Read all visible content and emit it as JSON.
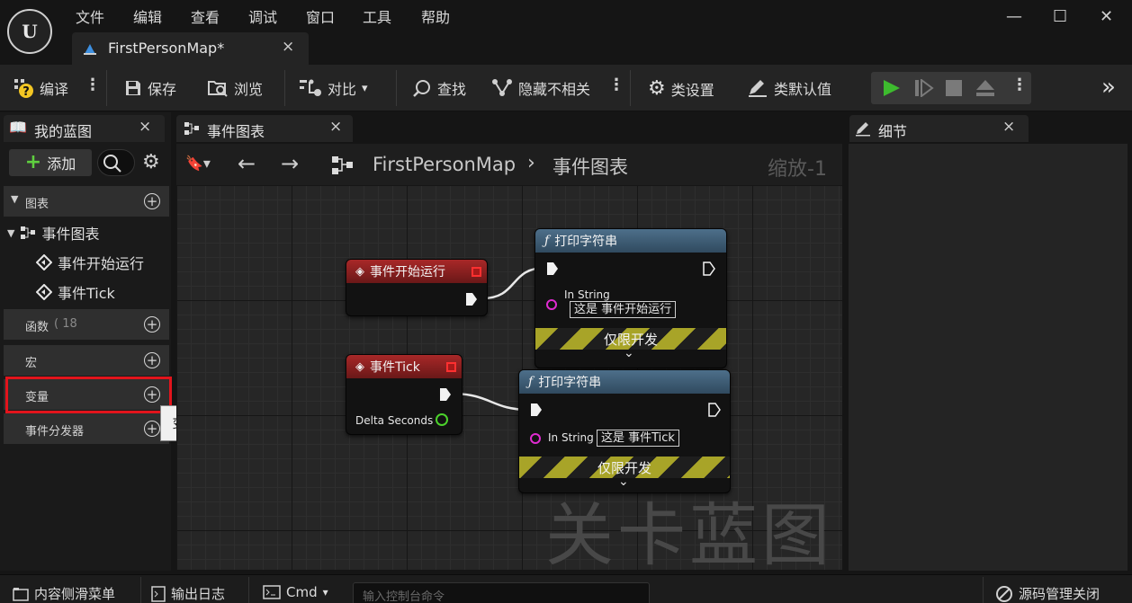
{
  "menu": [
    "文件",
    "编辑",
    "查看",
    "调试",
    "窗口",
    "工具",
    "帮助"
  ],
  "logo": {
    "text": "U",
    "icon": "unreal-logo-icon"
  },
  "doc_tab": {
    "label": "FirstPersonMap*",
    "close": "×"
  },
  "window_controls": {
    "minimize": "—",
    "maximize": "☐",
    "close": "✕"
  },
  "toolbar": {
    "compile": "编译",
    "save": "保存",
    "browse": "浏览",
    "diff": "对比",
    "find": "查找",
    "hide_unrelated": "隐藏不相关",
    "class_settings": "类设置",
    "class_defaults": "类默认值",
    "overflow": "»"
  },
  "left_panel": {
    "tab_label": "我的蓝图",
    "tab_close": "×",
    "add_label": "添加",
    "sections": {
      "graphs": "图表",
      "functions": "函数",
      "functions_count": "( 18",
      "macros": "宏",
      "variables": "变量",
      "dispatchers": "事件分发器"
    },
    "tree": {
      "event_graph": "事件图表",
      "begin_play": "事件开始运行",
      "tick": "事件Tick"
    },
    "tooltip": "变量"
  },
  "graph": {
    "tab_label": "事件图表",
    "tab_close": "×",
    "breadcrumb_root": "FirstPersonMap",
    "breadcrumb_sep": "›",
    "breadcrumb_leaf": "事件图表",
    "zoom": "缩放-1",
    "watermark": "关卡蓝图",
    "nodes": {
      "begin_play": {
        "title": "事件开始运行"
      },
      "tick": {
        "title": "事件Tick",
        "pin": "Delta Seconds"
      },
      "print1": {
        "title": "打印字符串",
        "pin": "In String",
        "value": "这是 事件开始运行",
        "dev": "仅限开发",
        "chevron": "⌄"
      },
      "print2": {
        "title": "打印字符串",
        "pin": "In String",
        "value": "这是 事件Tick",
        "dev": "仅限开发",
        "chevron": "⌄"
      }
    }
  },
  "details": {
    "tab_label": "细节",
    "tab_close": "×"
  },
  "statusbar": {
    "content_drawer": "内容侧滑菜单",
    "output_log": "输出日志",
    "cmd": "Cmd",
    "console_placeholder": "输入控制台命令",
    "source_control": "源码管理关闭"
  },
  "colors": {
    "event_head": "#a82828",
    "function_head": "#4d6f8a",
    "highlight": "#e2141c",
    "play": "#3dbb2e",
    "string_pin": "#e02bd0",
    "float_pin": "#4bd12b"
  }
}
